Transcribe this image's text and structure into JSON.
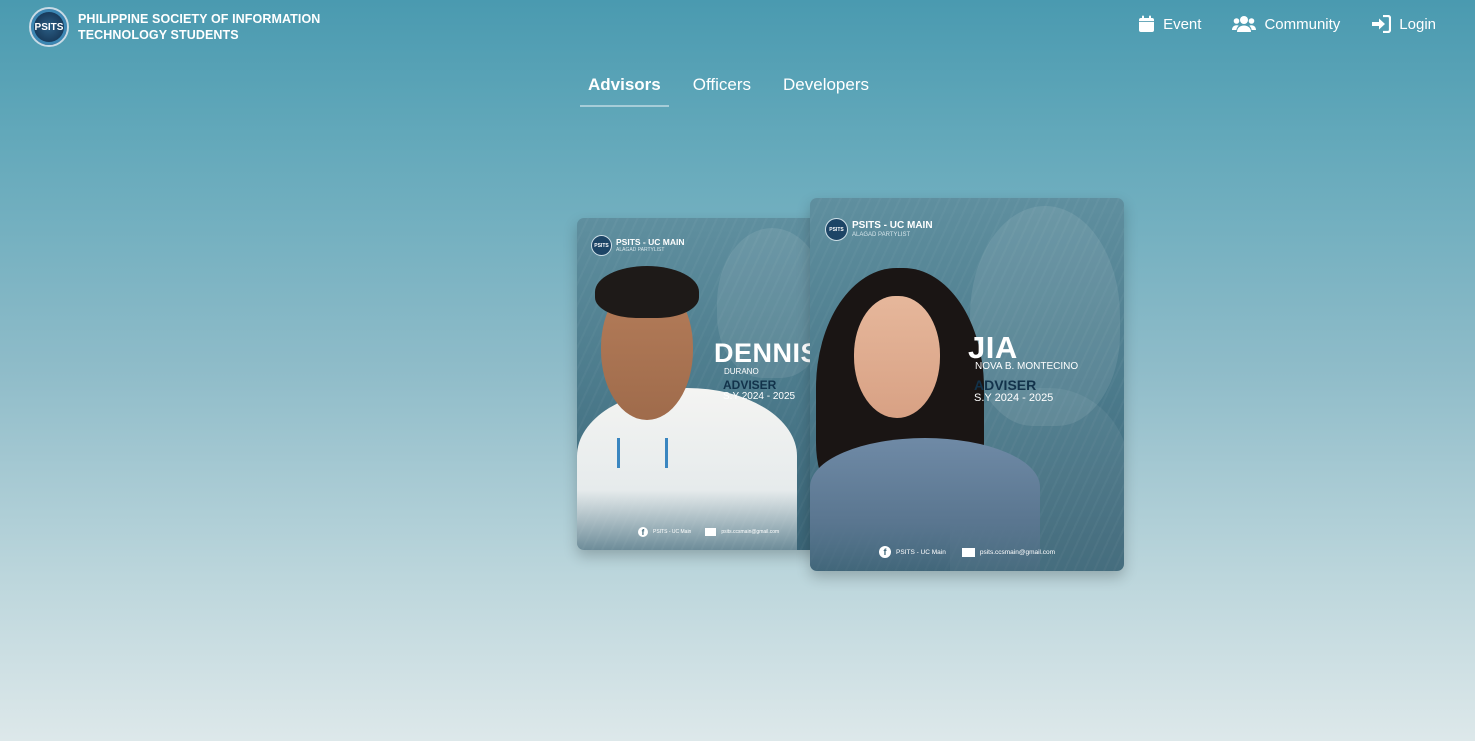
{
  "header": {
    "logo_text": "PSITS",
    "org_line1": "PHILIPPINE SOCIETY OF INFORMATION",
    "org_line2": "TECHNOLOGY STUDENTS",
    "nav": [
      {
        "label": "Event",
        "icon": "calendar-icon"
      },
      {
        "label": "Community",
        "icon": "users-icon"
      },
      {
        "label": "Login",
        "icon": "login-icon"
      }
    ]
  },
  "tabs": [
    {
      "label": "Advisors",
      "active": true
    },
    {
      "label": "Officers",
      "active": false
    },
    {
      "label": "Developers",
      "active": false
    }
  ],
  "cards": [
    {
      "org_name": "PSITS - UC MAIN",
      "org_sub": "ALAGAD PARTYLIST",
      "logo_text": "PSITS",
      "first_name": "DENNIS",
      "last_name": "DURANO",
      "role": "ADVISER",
      "school_year": "S.Y 2024 - 2025",
      "facebook": "PSITS - UC Main",
      "email": "psits.ccsmain@gmail.com"
    },
    {
      "org_name": "PSITS - UC MAIN",
      "org_sub": "ALAGAD PARTYLIST",
      "logo_text": "PSITS",
      "first_name": "JIA",
      "last_name": "NOVA B. MONTECINO",
      "role": "ADVISER",
      "school_year": "S.Y 2024 - 2025",
      "facebook": "PSITS - UC Main",
      "email": "psits.ccsmain@gmail.com"
    }
  ],
  "colors": {
    "accent_dark": "#12324a",
    "bg_top": "#4a9ab0",
    "bg_bottom": "#dde8ea"
  }
}
